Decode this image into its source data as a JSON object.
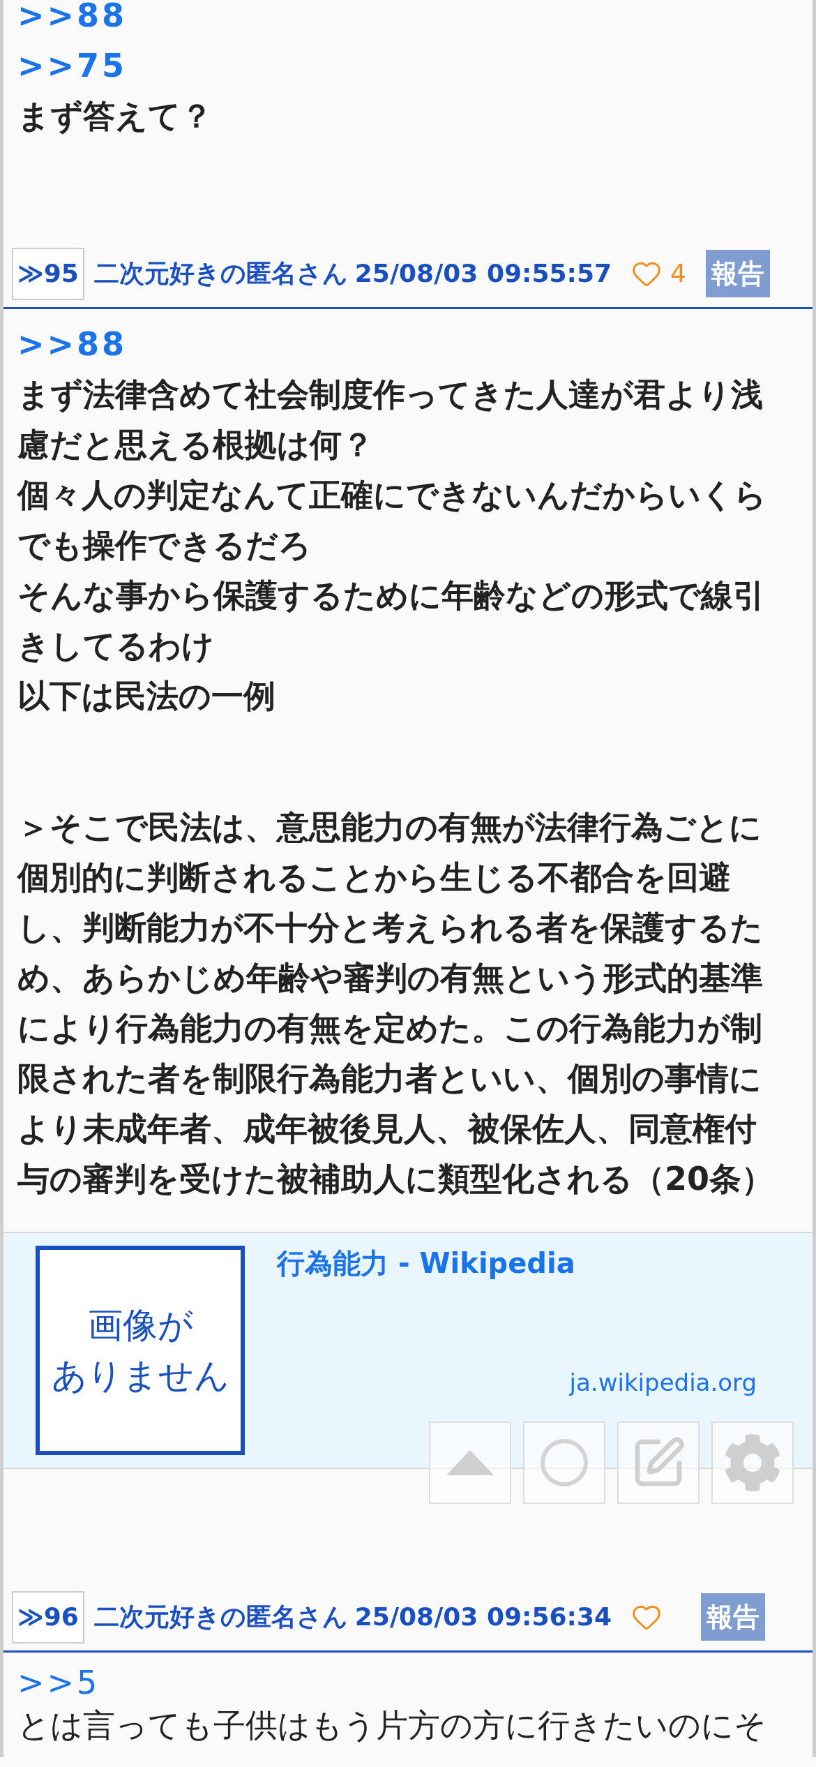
{
  "posts": [
    {
      "bold": true,
      "body": [
        {
          "kind": "anchor",
          "text": ">>88"
        },
        {
          "kind": "anchor",
          "text": ">>75"
        },
        {
          "kind": "text",
          "text": "まず答えて？"
        }
      ],
      "footer": {
        "number": "≫95",
        "name": "二次元好きの匿名さん",
        "date": "25/08/03 09:55:57",
        "likes": "4",
        "report": "報告"
      }
    },
    {
      "bold": true,
      "body": [
        {
          "kind": "anchor",
          "text": ">>88"
        },
        {
          "kind": "text",
          "text": "まず法律含めて社会制度作ってきた人達が君より浅慮だと思える根拠は何？"
        },
        {
          "kind": "text",
          "text": "個々人の判定なんて正確にできないんだからいくらでも操作できるだろ"
        },
        {
          "kind": "text",
          "text": "そんな事から保護するために年齢などの形式で線引きしてるわけ"
        },
        {
          "kind": "text",
          "text": "以下は民法の一例"
        },
        {
          "kind": "gap"
        },
        {
          "kind": "gap"
        },
        {
          "kind": "text",
          "text": "＞そこで民法は、意思能力の有無が法律行為ごとに個別的に判断されることから生じる不都合を回避し、判断能力が不十分と考えられる者を保護するため、あらかじめ年齢や審判の有無という形式的基準により行為能力の有無を定めた。この行為能力が制限された者を制限行為能力者といい、個別の事情により未成年者、成年被後見人、被保佐人、同意権付与の審判を受けた被補助人に類型化される（20条）"
        }
      ],
      "link_card": {
        "thumbnail_text": [
          "画像が",
          "ありません"
        ],
        "title": "行為能力 - Wikipedia",
        "domain": "ja.wikipedia.org"
      },
      "footer": {
        "number": "≫96",
        "name": "二次元好きの匿名さん",
        "date": "25/08/03 09:56:34",
        "report": "報告"
      }
    },
    {
      "bold": false,
      "body": [
        {
          "kind": "anchor",
          "text": ">>5"
        },
        {
          "kind": "text",
          "text": "とは言っても子供はもう片方の方に行きたいのにそ"
        }
      ]
    }
  ],
  "floating_buttons": [
    {
      "kind": "up"
    },
    {
      "kind": "reload"
    },
    {
      "kind": "write"
    },
    {
      "kind": "settings"
    }
  ]
}
